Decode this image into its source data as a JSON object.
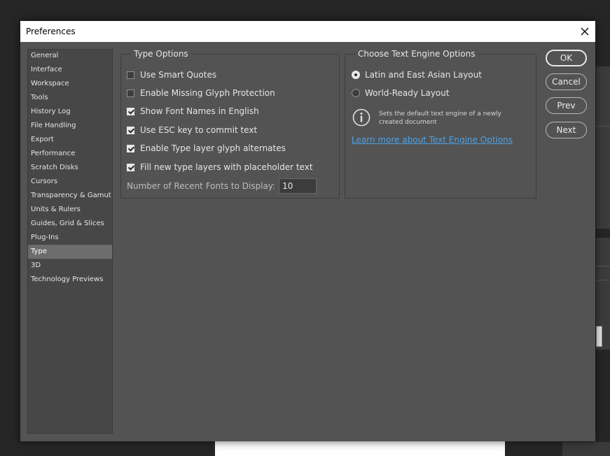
{
  "dialog": {
    "title": "Preferences",
    "close_icon": "close-icon"
  },
  "sidebar": {
    "items": [
      {
        "label": "General"
      },
      {
        "label": "Interface"
      },
      {
        "label": "Workspace"
      },
      {
        "label": "Tools"
      },
      {
        "label": "History Log"
      },
      {
        "label": "File Handling"
      },
      {
        "label": "Export"
      },
      {
        "label": "Performance"
      },
      {
        "label": "Scratch Disks"
      },
      {
        "label": "Cursors"
      },
      {
        "label": "Transparency & Gamut"
      },
      {
        "label": "Units & Rulers"
      },
      {
        "label": "Guides, Grid & Slices"
      },
      {
        "label": "Plug-Ins"
      },
      {
        "label": "Type"
      },
      {
        "label": "3D"
      },
      {
        "label": "Technology Previews"
      }
    ],
    "selected": "Type"
  },
  "type_options": {
    "legend": "Type Options",
    "checkboxes": [
      {
        "label": "Use Smart Quotes",
        "checked": false
      },
      {
        "label": "Enable Missing Glyph Protection",
        "checked": false
      },
      {
        "label": "Show Font Names in English",
        "checked": true
      },
      {
        "label": "Use ESC key to commit text",
        "checked": true
      },
      {
        "label": "Enable Type layer glyph alternates",
        "checked": true
      },
      {
        "label": "Fill new type layers with placeholder text",
        "checked": true
      }
    ],
    "recent_fonts": {
      "label": "Number of Recent Fonts to Display:",
      "value": "10"
    }
  },
  "engine_options": {
    "legend": "Choose Text Engine Options",
    "radios": [
      {
        "label": "Latin and East Asian Layout",
        "checked": true
      },
      {
        "label": "World-Ready Layout",
        "checked": false
      }
    ],
    "info_icon": "info-icon",
    "info_text": "Sets the default text engine of a newly created document",
    "learn_more": "Learn more about Text Engine Options",
    "link_color": "#4aa3ea"
  },
  "buttons": {
    "ok": "OK",
    "cancel": "Cancel",
    "prev": "Prev",
    "next": "Next"
  },
  "colors": {
    "dialog_bg": "#535353",
    "sidebar_bg": "#474747",
    "selected_bg": "#6d6d6d",
    "text": "#e6e6e6"
  }
}
